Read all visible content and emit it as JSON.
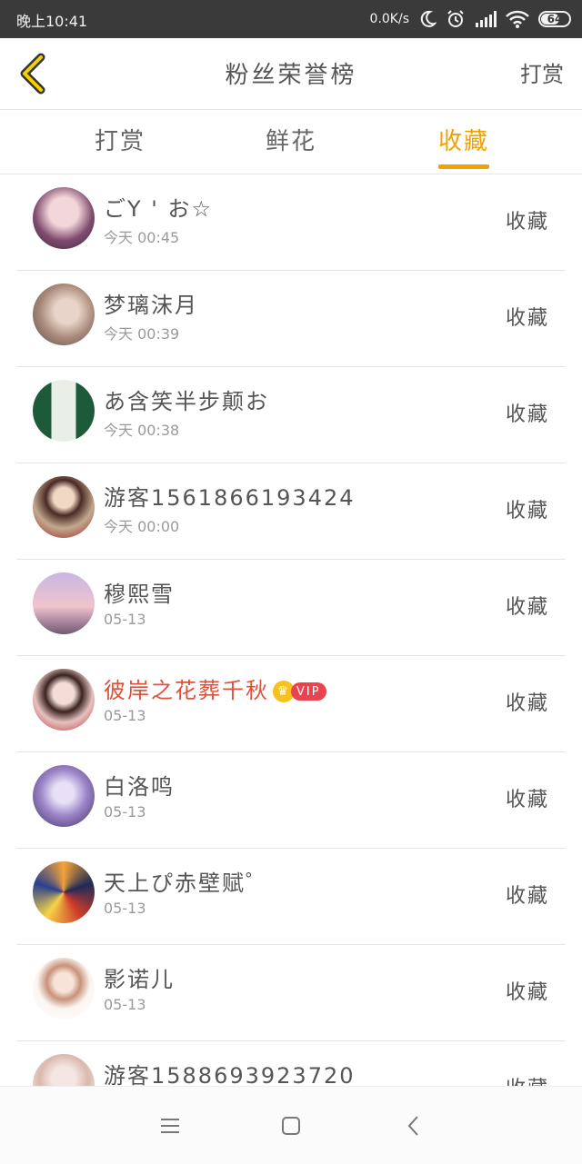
{
  "status_bar": {
    "time": "晚上10:41",
    "speed": "0.0K/s",
    "battery": "64",
    "icons": [
      "moon-icon",
      "alarm-icon",
      "signal-icon",
      "wifi-icon",
      "battery-icon"
    ]
  },
  "header": {
    "title": "粉丝荣誉榜",
    "action": "打赏",
    "back_icon": "chevron-left-icon"
  },
  "tabs": [
    {
      "label": "打赏",
      "active": false
    },
    {
      "label": "鲜花",
      "active": false
    },
    {
      "label": "收藏",
      "active": true
    }
  ],
  "colors": {
    "accent": "#f2a100",
    "vip_name": "#e0503a",
    "status_bar": "#3a3a3a"
  },
  "fans": [
    {
      "name": "ごY ' お☆",
      "time": "今天 00:45",
      "action": "收藏"
    },
    {
      "name": "梦璃沫月",
      "time": "今天 00:39",
      "action": "收藏"
    },
    {
      "name": "あ含笑半步颠お",
      "time": "今天 00:38",
      "action": "收藏"
    },
    {
      "name": "游客1561866193424",
      "time": "今天 00:00",
      "action": "收藏"
    },
    {
      "name": "穆熙雪",
      "time": "05-13",
      "action": "收藏"
    },
    {
      "name": "彼岸之花葬千秋",
      "time": "05-13",
      "action": "收藏",
      "vip": "VIP"
    },
    {
      "name": "白洛鸣",
      "time": "05-13",
      "action": "收藏"
    },
    {
      "name": "天上ぴ赤壁赋゜",
      "time": "05-13",
      "action": "收藏"
    },
    {
      "name": "影诺儿",
      "time": "05-13",
      "action": "收藏"
    },
    {
      "name": "游客1588693923720",
      "time": "",
      "action": "收藏"
    }
  ],
  "nav_bar": {
    "icons": [
      "menu-icon",
      "home-square-icon",
      "back-icon"
    ]
  }
}
